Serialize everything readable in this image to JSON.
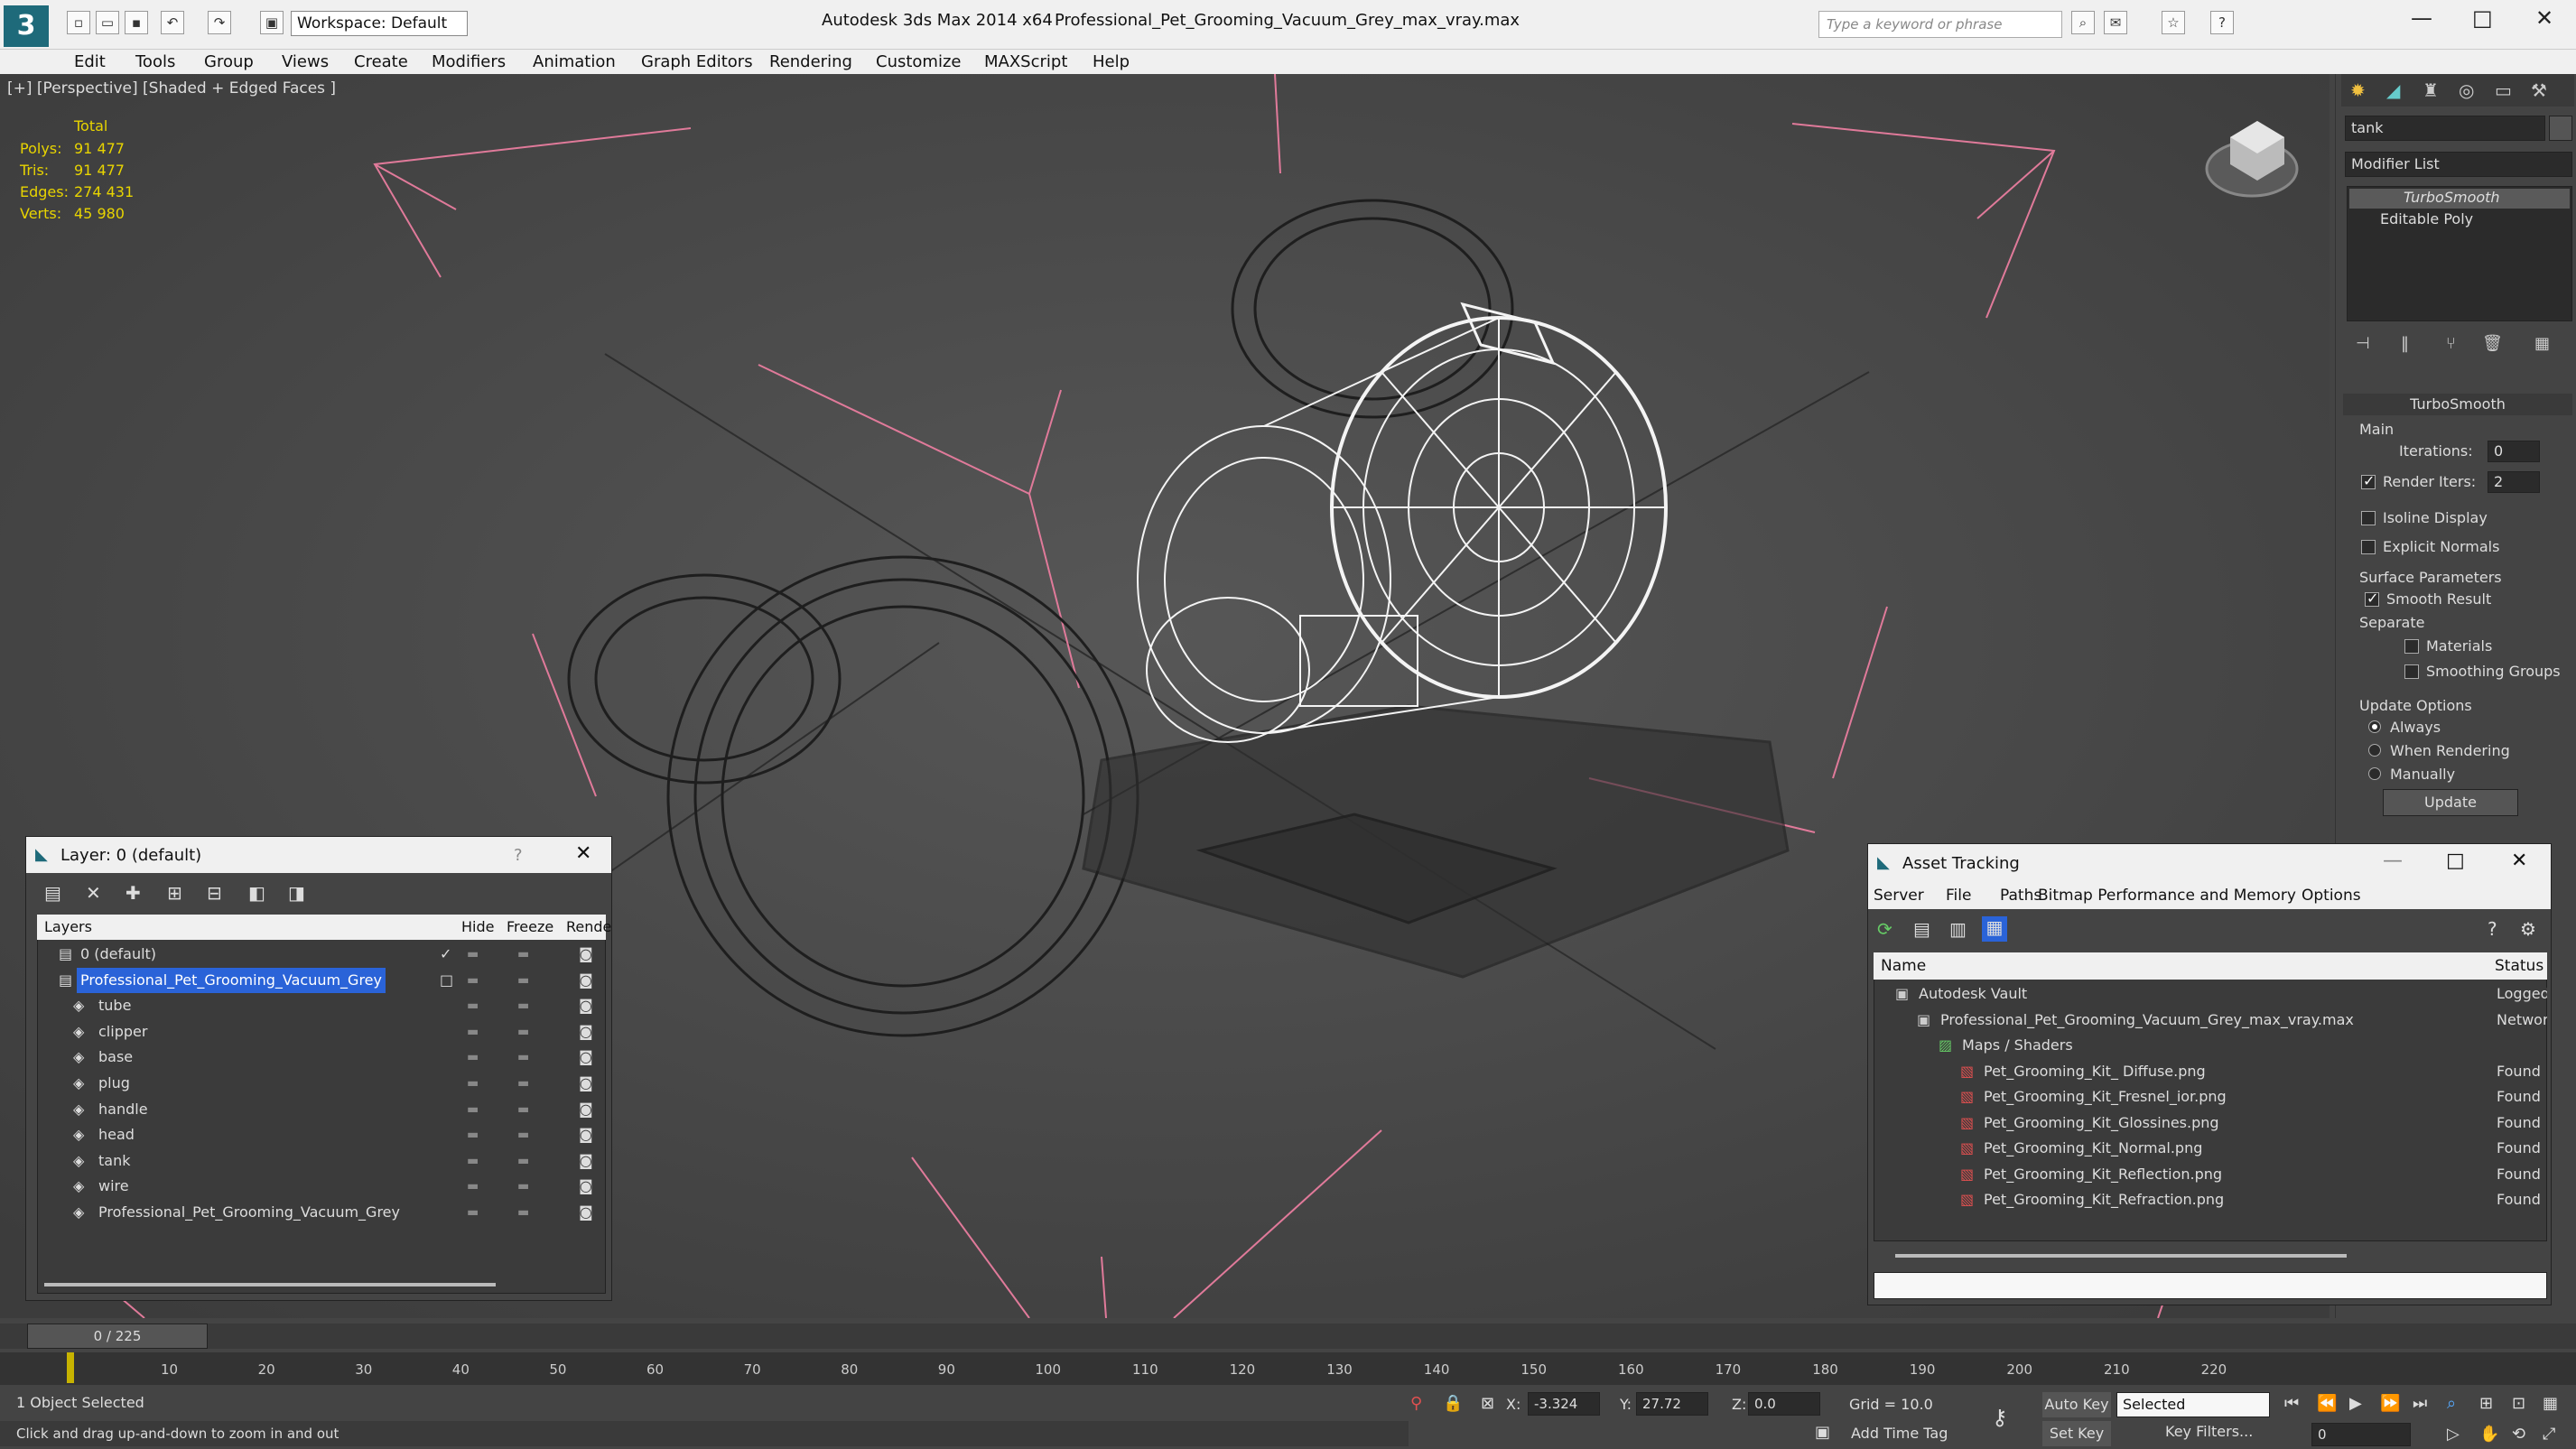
{
  "titlebar": {
    "app": "Autodesk 3ds Max  2014 x64",
    "file": "Professional_Pet_Grooming_Vacuum_Grey_max_vray.max",
    "workspace": "Workspace: Default",
    "search_placeholder": "Type a keyword or phrase"
  },
  "menu": [
    "Edit",
    "Tools",
    "Group",
    "Views",
    "Create",
    "Modifiers",
    "Animation",
    "Graph Editors",
    "Rendering",
    "Customize",
    "MAXScript",
    "Help"
  ],
  "viewport": {
    "label": "[+] [Perspective] [Shaded + Edged Faces ]",
    "stats": {
      "header": "Total",
      "rows": [
        {
          "label": "Polys:",
          "value": "91 477"
        },
        {
          "label": "Tris:",
          "value": "91 477"
        },
        {
          "label": "Edges:",
          "value": "274 431"
        },
        {
          "label": "Verts:",
          "value": "45 980"
        }
      ]
    }
  },
  "command_panel": {
    "object_name": "tank",
    "modifier_list": "Modifier List",
    "stack": [
      "TurboSmooth",
      "Editable Poly"
    ],
    "rollout_title": "TurboSmooth",
    "main_label": "Main",
    "iterations_label": "Iterations:",
    "iterations_value": "0",
    "render_iters_label": "Render Iters:",
    "render_iters_value": "2",
    "isoline": "Isoline Display",
    "explicit_normals": "Explicit Normals",
    "surface_params": "Surface Parameters",
    "smooth_result": "Smooth Result",
    "separate": "Separate",
    "materials": "Materials",
    "smoothing_groups": "Smoothing Groups",
    "update_options": "Update Options",
    "always": "Always",
    "when_rendering": "When Rendering",
    "manually": "Manually",
    "update_button": "Update"
  },
  "layer_dialog": {
    "title": "Layer: 0 (default)",
    "help": "?",
    "columns": [
      "Layers",
      "Hide",
      "Freeze",
      "Rende"
    ],
    "rows": [
      {
        "name": "0 (default)",
        "indent": 0
      },
      {
        "name": "Professional_Pet_Grooming_Vacuum_Grey",
        "indent": 0,
        "selected": true
      },
      {
        "name": "tube",
        "indent": 1
      },
      {
        "name": "clipper",
        "indent": 1
      },
      {
        "name": "base",
        "indent": 1
      },
      {
        "name": "plug",
        "indent": 1
      },
      {
        "name": "handle",
        "indent": 1
      },
      {
        "name": "head",
        "indent": 1
      },
      {
        "name": "tank",
        "indent": 1
      },
      {
        "name": "wire",
        "indent": 1
      },
      {
        "name": "Professional_Pet_Grooming_Vacuum_Grey",
        "indent": 1
      }
    ]
  },
  "asset_dialog": {
    "title": "Asset Tracking",
    "menu": [
      "Server",
      "File",
      "Paths",
      "Bitmap Performance and Memory",
      "Options"
    ],
    "columns": [
      "Name",
      "Status"
    ],
    "rows": [
      {
        "name": "Autodesk Vault",
        "status": "Logged Ou",
        "indent": 1
      },
      {
        "name": "Professional_Pet_Grooming_Vacuum_Grey_max_vray.max",
        "status": "Network Pa",
        "indent": 2
      },
      {
        "name": "Maps / Shaders",
        "status": "",
        "indent": 3
      },
      {
        "name": "Pet_Grooming_Kit_ Diffuse.png",
        "status": "Found",
        "indent": 4
      },
      {
        "name": "Pet_Grooming_Kit_Fresnel_ior.png",
        "status": "Found",
        "indent": 4
      },
      {
        "name": "Pet_Grooming_Kit_Glossines.png",
        "status": "Found",
        "indent": 4
      },
      {
        "name": "Pet_Grooming_Kit_Normal.png",
        "status": "Found",
        "indent": 4
      },
      {
        "name": "Pet_Grooming_Kit_Reflection.png",
        "status": "Found",
        "indent": 4
      },
      {
        "name": "Pet_Grooming_Kit_Refraction.png",
        "status": "Found",
        "indent": 4
      }
    ]
  },
  "timeline": {
    "frame": "0 / 225",
    "ticks": [
      "10",
      "20",
      "30",
      "40",
      "50",
      "60",
      "70",
      "80",
      "90",
      "100",
      "110",
      "120",
      "130",
      "140",
      "150",
      "160",
      "170",
      "180",
      "190",
      "200",
      "210",
      "220"
    ]
  },
  "status": {
    "selected": "1 Object Selected",
    "prompt": "Click and drag up-and-down to zoom in and out",
    "x_label": "X:",
    "x_value": "-3.324",
    "y_label": "Y:",
    "y_value": "27.72",
    "z_label": "Z:",
    "z_value": "0.0",
    "grid": "Grid = 10.0",
    "add_time_tag": "Add Time Tag",
    "auto_key": "Auto Key",
    "set_key": "Set Key",
    "selected_dropdown": "Selected",
    "key_filters": "Key Filters...",
    "frame_value": "0"
  }
}
